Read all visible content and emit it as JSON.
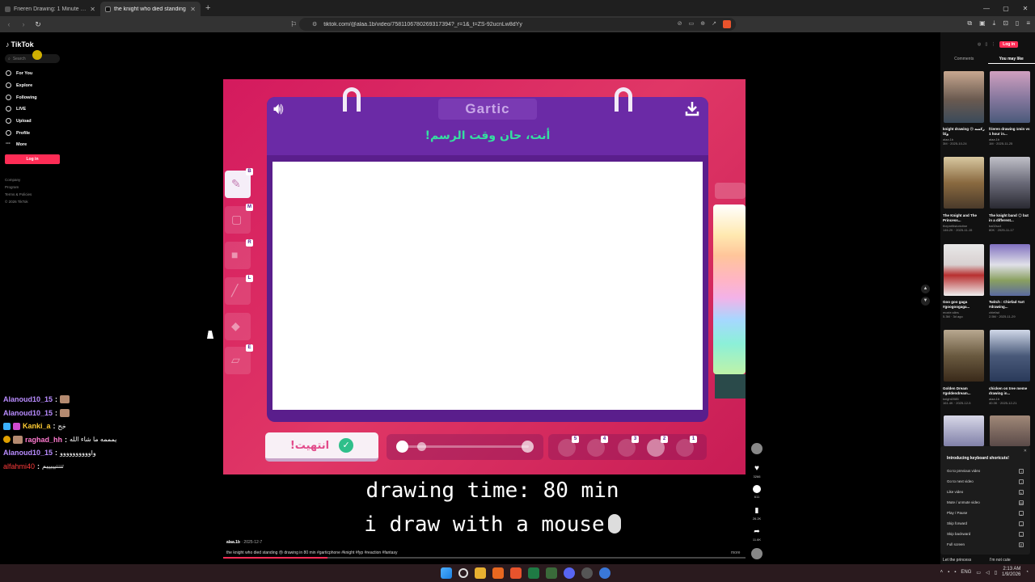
{
  "browser": {
    "tabs": [
      {
        "title": "Frieren Drawing: 1 Minute vs 1 Hour",
        "active": false
      },
      {
        "title": "the knight who died standing",
        "active": true
      }
    ],
    "url": "tiktok.com/@alaa.1b/video/7581106780269317394?_r=1&_t=ZS-92ucnLw8dYy"
  },
  "tiktok": {
    "logo": "TikTok",
    "search_placeholder": "Search",
    "nav": [
      "For You",
      "Explore",
      "Following",
      "LIVE",
      "Upload",
      "Profile",
      "More"
    ],
    "login_label": "Log in",
    "footer": [
      "Company",
      "Program",
      "Terms & Policies",
      "© 2026 TikTok"
    ],
    "top_login": "Log in",
    "tabs": [
      "Comments",
      "You may like"
    ]
  },
  "chat": [
    {
      "user": "Alanoud10_15",
      "color": "#b98cff",
      "message": ""
    },
    {
      "user": "Alanoud10_15",
      "color": "#b98cff",
      "message": ""
    },
    {
      "user": "Kanki_a",
      "color": "#ffcc33",
      "message": "خح"
    },
    {
      "user": "raghad_hh",
      "color": "#ff7ad0",
      "message": "يمممه ما شاء الله"
    },
    {
      "user": "Alanoud10_15",
      "color": "#b98cff",
      "message": "واوووووووووو"
    },
    {
      "user": "alfahmi40",
      "color": "#ff3b3b",
      "message": "تنننيييييم"
    }
  ],
  "game": {
    "title": "Gartic",
    "prompt": "أنت، حان وقت الرسم!",
    "tool_keys": [
      "B",
      "M",
      "R",
      "L",
      "",
      "E"
    ],
    "done_label": "انتهيت!",
    "size_numbers": [
      "5",
      "4",
      "3",
      "2",
      "1"
    ]
  },
  "caption": {
    "line1": "drawing time: 80 min",
    "line2": "i draw with a mouse"
  },
  "video_meta": {
    "author": "alaa.1b",
    "date": "2025-12-7",
    "description": "the knight who died standing 😢 drawing in 80 min #garticphone #knight #fyp #reaction #fantasy",
    "more": "more",
    "progress": 0.2,
    "counts": [
      "3266",
      "611",
      "26.2K",
      "11.6K"
    ]
  },
  "recommended": [
    {
      "caption": "knight drawing 😢 ركشه وكا",
      "author": "alaa.1b",
      "meta": "3M · 2025-10-24"
    },
    {
      "caption": "frieren drawing 1min vs 1 hour in...",
      "author": "alaa.1b",
      "meta": "1M · 2025-11-25"
    },
    {
      "caption": "The Knight and The Princess...",
      "author": "thepreltistorictine",
      "meta": "146.2K · 2025-11-15"
    },
    {
      "caption": "The knight band 😉 but in a different...",
      "author": "ba02so4",
      "meta": "80K · 2025-11-17"
    },
    {
      "caption": "Goo goo gaga #googoogaga...",
      "author": "moxie.siles",
      "meta": "5.3M · 3d ago"
    },
    {
      "caption": "Twitch : Chiefad #art #drawing...",
      "author": "chiefad",
      "meta": "2.5M · 2025-11-29"
    },
    {
      "caption": "Golden Dream #goldendream...",
      "author": "knight2085",
      "meta": "161.4K · 2025-12-5"
    },
    {
      "caption": "chicken on tree meme drawing in...",
      "author": "alaa.1b",
      "meta": "40.3K · 2025-12-21"
    }
  ],
  "shortcuts": {
    "title": "Introducing keyboard shortcuts!",
    "items": [
      {
        "label": "Go to previous video",
        "key": "↑"
      },
      {
        "label": "Go to next video",
        "key": "↓"
      },
      {
        "label": "Like video",
        "key": "L"
      },
      {
        "label": "Mute / unmute video",
        "key": "M"
      },
      {
        "label": "Play / Pause",
        "key": "␣"
      },
      {
        "label": "Skip forward",
        "key": "→"
      },
      {
        "label": "Skip backward",
        "key": "←"
      },
      {
        "label": "Full screen",
        "key": "F"
      }
    ],
    "footer_left": "Let the princess",
    "footer_right": "I'm not cute"
  },
  "taskbar": {
    "lang": "ENG",
    "time": "2:13 AM",
    "date": "1/9/2026"
  }
}
